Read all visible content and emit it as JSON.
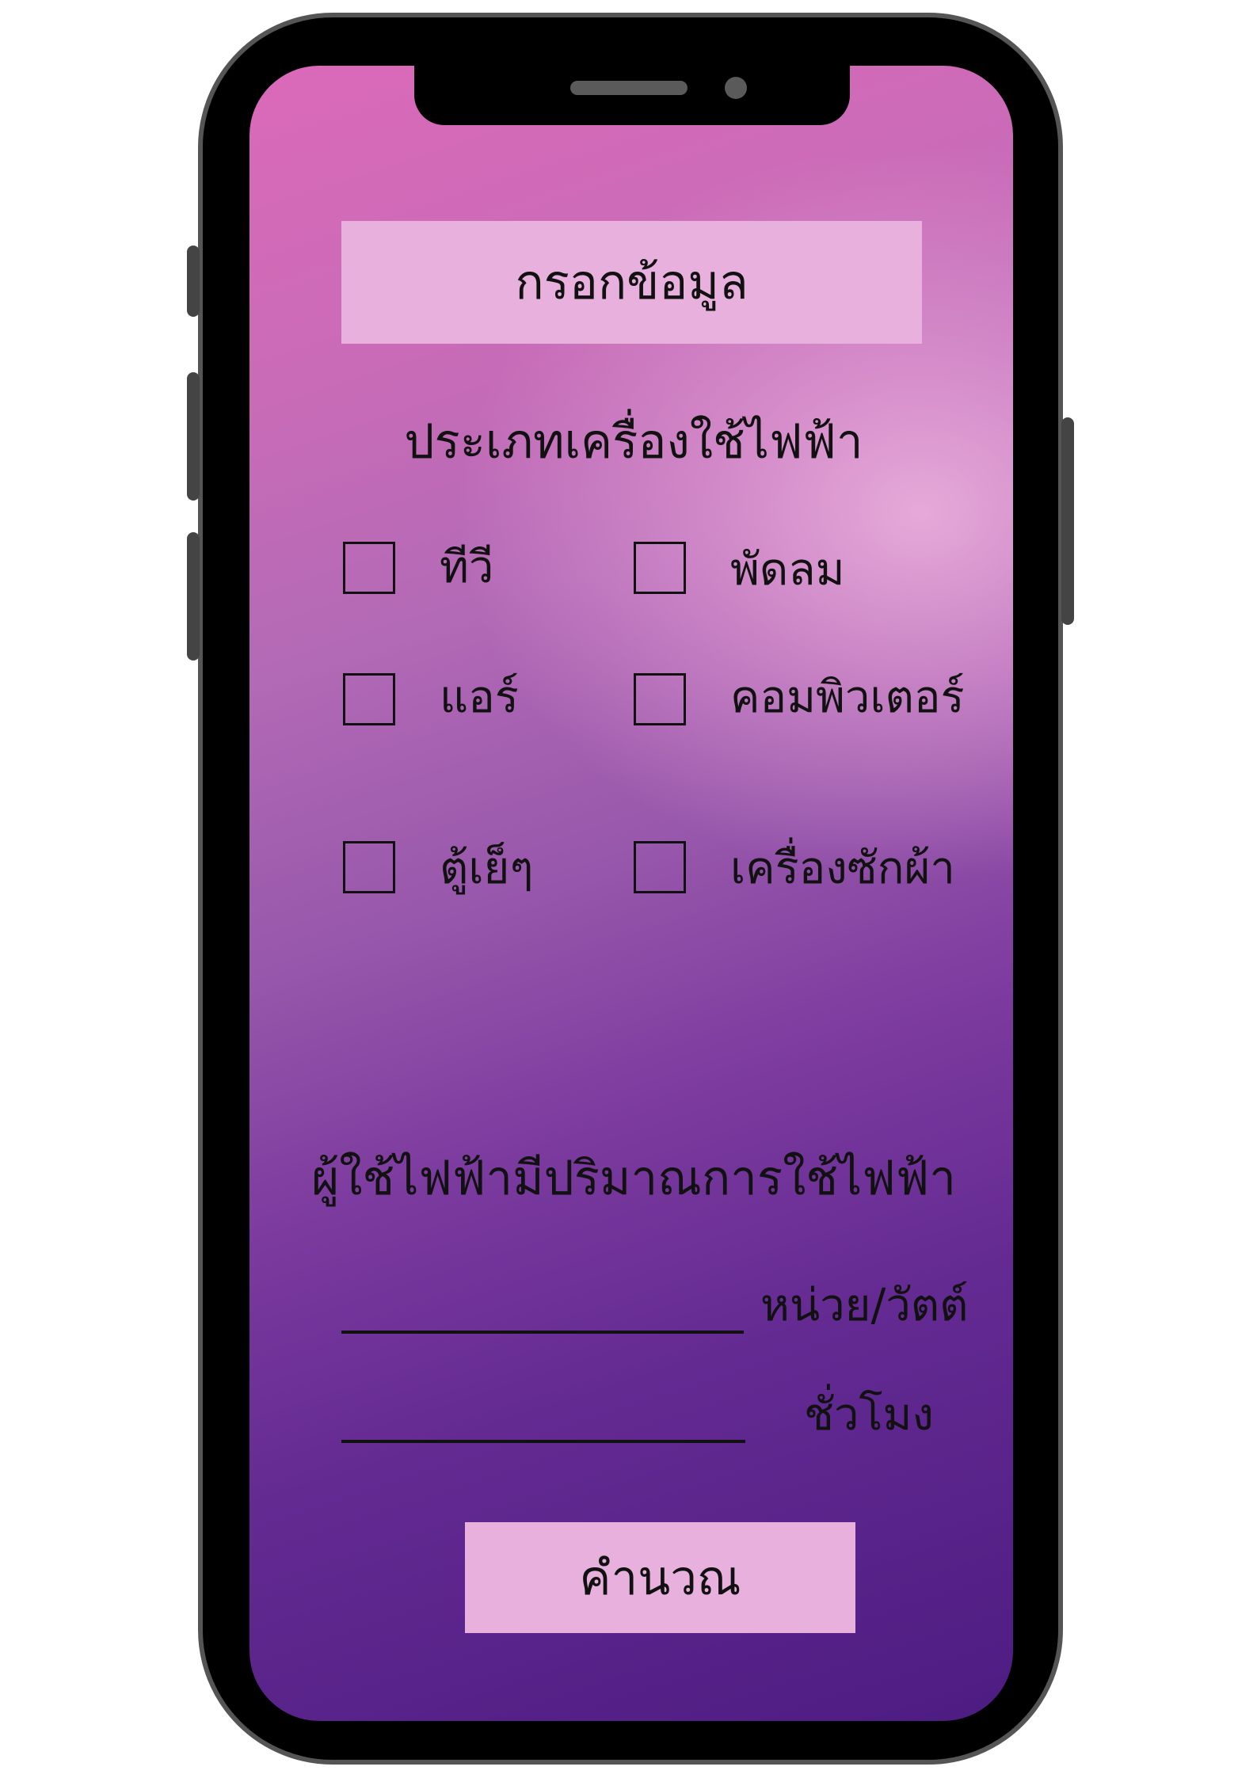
{
  "form": {
    "title": "กรอกข้อมูล",
    "appliance_heading": "ประเภทเครื่องใช้ไฟฟ้า",
    "appliances": [
      {
        "label": "ทีวี",
        "checked": false
      },
      {
        "label": "พัดลม",
        "checked": false
      },
      {
        "label": "แอร์",
        "checked": false
      },
      {
        "label": "คอมพิวเตอร์",
        "checked": false
      },
      {
        "label": "ตู้เย็ๆ",
        "checked": false
      },
      {
        "label": "เครื่องซักผ้า",
        "checked": false
      }
    ],
    "usage_heading": "ผู้ใช้ไฟฟ้ามีปริมาณการใช้ไฟฟ้า",
    "watt_unit": "หน่วย/วัตต์",
    "hours_unit": "ชั่วโมง",
    "calculate_label": "คำนวณ"
  },
  "colors": {
    "frame": "#000000",
    "frame_border": "#555555",
    "button_bg": "#e8b0dc",
    "gradient_top": "#db6ab9",
    "gradient_bottom": "#4d1c82"
  }
}
